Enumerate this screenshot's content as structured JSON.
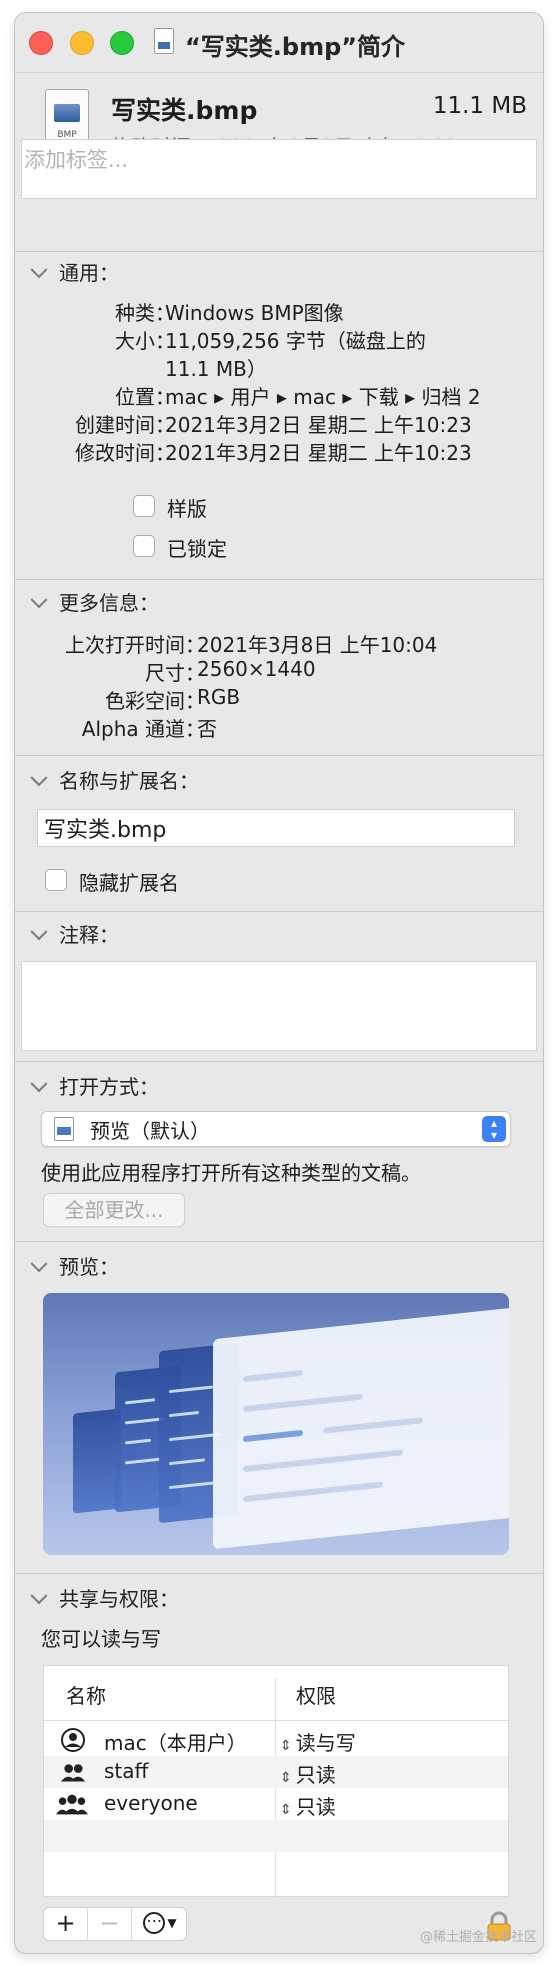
{
  "window": {
    "title": "“写实类.bmp”简介"
  },
  "file": {
    "name": "写实类.bmp",
    "size": "11.1 MB",
    "modified_line": "修改时间： 2021年3月2日 上午10:23",
    "icon_ext": "BMP"
  },
  "tags": {
    "placeholder": "添加标签..."
  },
  "general": {
    "heading": "通用：",
    "rows": [
      {
        "key": "种类：",
        "value": "Windows BMP图像"
      },
      {
        "key": "大小：",
        "value": "11,059,256 字节（磁盘上的"
      },
      {
        "key": "",
        "value": "11.1 MB）"
      },
      {
        "key": "位置：",
        "value": "mac ▸ 用户 ▸ mac ▸ 下载 ▸ 归档 2"
      },
      {
        "key": "创建时间：",
        "value": "2021年3月2日 星期二 上午10:23"
      },
      {
        "key": "修改时间：",
        "value": "2021年3月2日 星期二 上午10:23"
      }
    ],
    "stationery_label": "样版",
    "locked_label": "已锁定"
  },
  "more_info": {
    "heading": "更多信息：",
    "rows": [
      {
        "key": "上次打开时间：",
        "value": "2021年3月8日 上午10:04"
      },
      {
        "key": "尺寸：",
        "value": "2560×1440"
      },
      {
        "key": "色彩空间：",
        "value": "RGB"
      },
      {
        "key": "Alpha 通道：",
        "value": "否"
      }
    ]
  },
  "name_ext": {
    "heading": "名称与扩展名：",
    "value": "写实类.bmp",
    "hide_ext_label": "隐藏扩展名"
  },
  "comments": {
    "heading": "注释："
  },
  "open_with": {
    "heading": "打开方式：",
    "app": "预览（默认）",
    "description": "使用此应用程序打开所有这种类型的文稿。",
    "change_all": "全部更改..."
  },
  "preview": {
    "heading": "预览："
  },
  "sharing": {
    "heading": "共享与权限：",
    "status": "您可以读与写",
    "col_name": "名称",
    "col_privilege": "权限",
    "rows": [
      {
        "name": "mac（本用户）",
        "privilege": "读与写",
        "icon": "single-user-icon"
      },
      {
        "name": "staff",
        "privilege": "只读",
        "icon": "group-icon"
      },
      {
        "name": "everyone",
        "privilege": "只读",
        "icon": "everyone-icon"
      }
    ]
  },
  "toolbar": {
    "add": "+",
    "remove": "−",
    "action": "⋯"
  },
  "watermark": "@稀土掘金技术社区",
  "colors": {
    "close": "#fe5f57",
    "minimize": "#febc2e",
    "zoom": "#28c840",
    "accent": "#3b82f7"
  }
}
